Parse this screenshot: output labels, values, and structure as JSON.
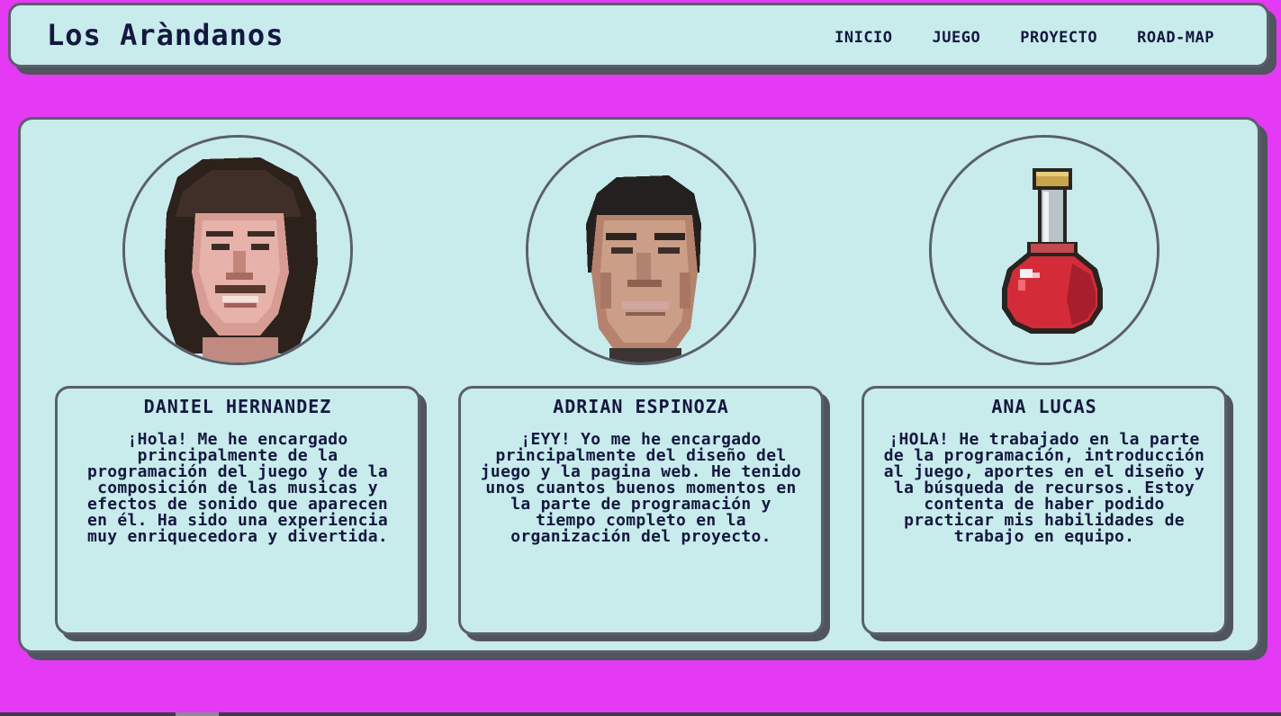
{
  "header": {
    "brand": "Los Aràndanos",
    "nav": [
      "INICIO",
      "JUEGO",
      "PROYECTO",
      "ROAD-MAP"
    ]
  },
  "team": [
    {
      "name": "DANIEL HERNANDEZ",
      "bio": "¡Hola! Me he encargado principalmente de la programación del juego y de la composición de las musicas y efectos de sonido que aparecen en él. Ha sido una experiencia muy enriquecedora y divertida.",
      "avatar_icon": "pixel-portrait-icon"
    },
    {
      "name": "ADRIAN ESPINOZA",
      "bio": "¡EYY! Yo me he encargado principalmente del diseño del juego y la pagina web. He tenido unos cuantos buenos momentos en la parte de programación y tiempo completo en la organización del proyecto.",
      "avatar_icon": "pixel-portrait-icon"
    },
    {
      "name": "ANA LUCAS",
      "bio": "¡HOLA! He trabajado en la parte de la programación, introducción al juego, aportes en el diseño y la búsqueda de recursos. Estoy contenta de haber podido practicar mis habilidades de trabajo en equipo.",
      "avatar_icon": "red-potion-icon"
    }
  ],
  "colors": {
    "background": "#e43af3",
    "panel": "#c8ebec",
    "border": "#5a5f6b",
    "text": "#14183f"
  }
}
